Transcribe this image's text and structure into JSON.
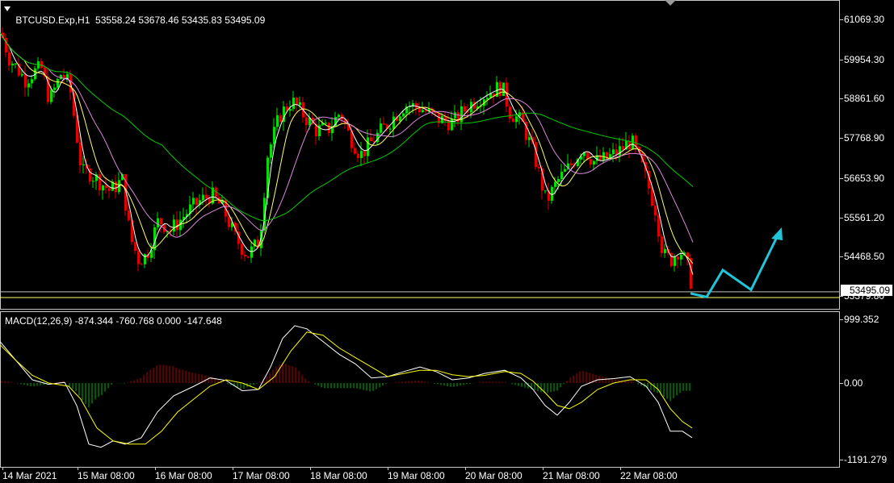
{
  "header": {
    "symbol": "BTCUSD.Exp,H1",
    "ohlc": "53558.24 53678.46 53435.83 53495.09"
  },
  "price_axis": {
    "labels": [
      "61069.30",
      "59954.30",
      "58861.60",
      "57768.90",
      "56653.90",
      "55561.20",
      "54468.50",
      "53379.80"
    ],
    "current_price": "53495.09"
  },
  "macd": {
    "header": "MACD(12,26,9) -874.344 -760.768 0.000 -147.648",
    "axis_labels": [
      "999.352",
      "0.00",
      "-1191.279"
    ]
  },
  "time_axis": {
    "labels": [
      "14 Mar 2021",
      "15 Mar 08:00",
      "16 Mar 08:00",
      "17 Mar 08:00",
      "18 Mar 08:00",
      "19 Mar 08:00",
      "20 Mar 08:00",
      "21 Mar 08:00",
      "22 Mar 08:00"
    ]
  },
  "colors": {
    "bull": "#00e000",
    "bear": "#e00000",
    "ma_fast": "#ffffff",
    "ma_yellow": "#ffff66",
    "ma_violet": "#dd88dd",
    "ma_green": "#00cc00",
    "signal": "#ffff00",
    "arrow": "#22c4d8"
  },
  "chart_data": {
    "type": "candlestick",
    "ohlc_last": [
      53558.24,
      53678.46,
      53435.83,
      53495.09
    ],
    "close_path": [
      [
        0,
        60700
      ],
      [
        10,
        60000
      ],
      [
        20,
        59700
      ],
      [
        30,
        59400
      ],
      [
        40,
        59600
      ],
      [
        50,
        59700
      ],
      [
        60,
        58800
      ],
      [
        75,
        59600
      ],
      [
        85,
        59200
      ],
      [
        92,
        58100
      ],
      [
        100,
        56800
      ],
      [
        110,
        56800
      ],
      [
        120,
        56600
      ],
      [
        135,
        56300
      ],
      [
        150,
        56600
      ],
      [
        160,
        55000
      ],
      [
        170,
        54400
      ],
      [
        180,
        54500
      ],
      [
        195,
        55500
      ],
      [
        210,
        55200
      ],
      [
        230,
        55700
      ],
      [
        245,
        56000
      ],
      [
        260,
        56200
      ],
      [
        275,
        55800
      ],
      [
        290,
        55000
      ],
      [
        305,
        54500
      ],
      [
        320,
        54900
      ],
      [
        330,
        57300
      ],
      [
        345,
        58400
      ],
      [
        360,
        58800
      ],
      [
        375,
        58400
      ],
      [
        390,
        58000
      ],
      [
        405,
        58000
      ],
      [
        420,
        58500
      ],
      [
        430,
        57900
      ],
      [
        445,
        57300
      ],
      [
        460,
        57700
      ],
      [
        480,
        58200
      ],
      [
        500,
        58700
      ],
      [
        520,
        58600
      ],
      [
        540,
        58300
      ],
      [
        560,
        58200
      ],
      [
        580,
        58700
      ],
      [
        600,
        59000
      ],
      [
        620,
        59200
      ],
      [
        630,
        58500
      ],
      [
        645,
        58200
      ],
      [
        660,
        57300
      ],
      [
        675,
        56000
      ],
      [
        690,
        56600
      ],
      [
        705,
        57000
      ],
      [
        720,
        57500
      ],
      [
        735,
        57100
      ],
      [
        750,
        57200
      ],
      [
        765,
        57400
      ],
      [
        780,
        57700
      ],
      [
        795,
        56900
      ],
      [
        810,
        55800
      ],
      [
        820,
        54500
      ],
      [
        830,
        54400
      ],
      [
        840,
        54700
      ],
      [
        850,
        54200
      ],
      [
        857,
        53500
      ]
    ],
    "projection_arrow": [
      [
        855,
        53450
      ],
      [
        875,
        53350
      ],
      [
        895,
        54100
      ],
      [
        930,
        53550
      ],
      [
        965,
        55150
      ]
    ],
    "macd_main": [
      [
        0,
        650
      ],
      [
        20,
        350
      ],
      [
        40,
        50
      ],
      [
        60,
        -20
      ],
      [
        80,
        10
      ],
      [
        95,
        -350
      ],
      [
        110,
        -950
      ],
      [
        125,
        -1000
      ],
      [
        140,
        -900
      ],
      [
        155,
        -950
      ],
      [
        175,
        -850
      ],
      [
        195,
        -450
      ],
      [
        215,
        -200
      ],
      [
        240,
        -50
      ],
      [
        260,
        80
      ],
      [
        280,
        40
      ],
      [
        300,
        -120
      ],
      [
        320,
        -100
      ],
      [
        335,
        250
      ],
      [
        350,
        700
      ],
      [
        365,
        900
      ],
      [
        380,
        850
      ],
      [
        400,
        650
      ],
      [
        420,
        450
      ],
      [
        440,
        300
      ],
      [
        460,
        80
      ],
      [
        480,
        100
      ],
      [
        500,
        180
      ],
      [
        520,
        250
      ],
      [
        540,
        180
      ],
      [
        560,
        50
      ],
      [
        580,
        80
      ],
      [
        600,
        150
      ],
      [
        625,
        200
      ],
      [
        645,
        80
      ],
      [
        660,
        -100
      ],
      [
        675,
        -350
      ],
      [
        690,
        -500
      ],
      [
        705,
        -300
      ],
      [
        720,
        -50
      ],
      [
        740,
        50
      ],
      [
        760,
        70
      ],
      [
        780,
        100
      ],
      [
        800,
        -50
      ],
      [
        815,
        -300
      ],
      [
        830,
        -750
      ],
      [
        845,
        -750
      ],
      [
        857,
        -850
      ]
    ],
    "macd_signal": [
      [
        0,
        600
      ],
      [
        20,
        350
      ],
      [
        40,
        120
      ],
      [
        60,
        0
      ],
      [
        85,
        -50
      ],
      [
        100,
        -250
      ],
      [
        120,
        -700
      ],
      [
        140,
        -900
      ],
      [
        160,
        -950
      ],
      [
        180,
        -950
      ],
      [
        200,
        -750
      ],
      [
        220,
        -450
      ],
      [
        240,
        -250
      ],
      [
        260,
        -50
      ],
      [
        280,
        50
      ],
      [
        300,
        0
      ],
      [
        320,
        -100
      ],
      [
        340,
        100
      ],
      [
        360,
        500
      ],
      [
        380,
        800
      ],
      [
        400,
        750
      ],
      [
        420,
        550
      ],
      [
        440,
        400
      ],
      [
        460,
        250
      ],
      [
        480,
        100
      ],
      [
        500,
        150
      ],
      [
        520,
        200
      ],
      [
        540,
        200
      ],
      [
        560,
        130
      ],
      [
        580,
        100
      ],
      [
        600,
        120
      ],
      [
        625,
        180
      ],
      [
        645,
        150
      ],
      [
        660,
        30
      ],
      [
        675,
        -150
      ],
      [
        690,
        -350
      ],
      [
        705,
        -400
      ],
      [
        720,
        -300
      ],
      [
        740,
        -100
      ],
      [
        760,
        0
      ],
      [
        780,
        50
      ],
      [
        800,
        50
      ],
      [
        815,
        -100
      ],
      [
        830,
        -400
      ],
      [
        845,
        -600
      ],
      [
        857,
        -700
      ]
    ]
  }
}
